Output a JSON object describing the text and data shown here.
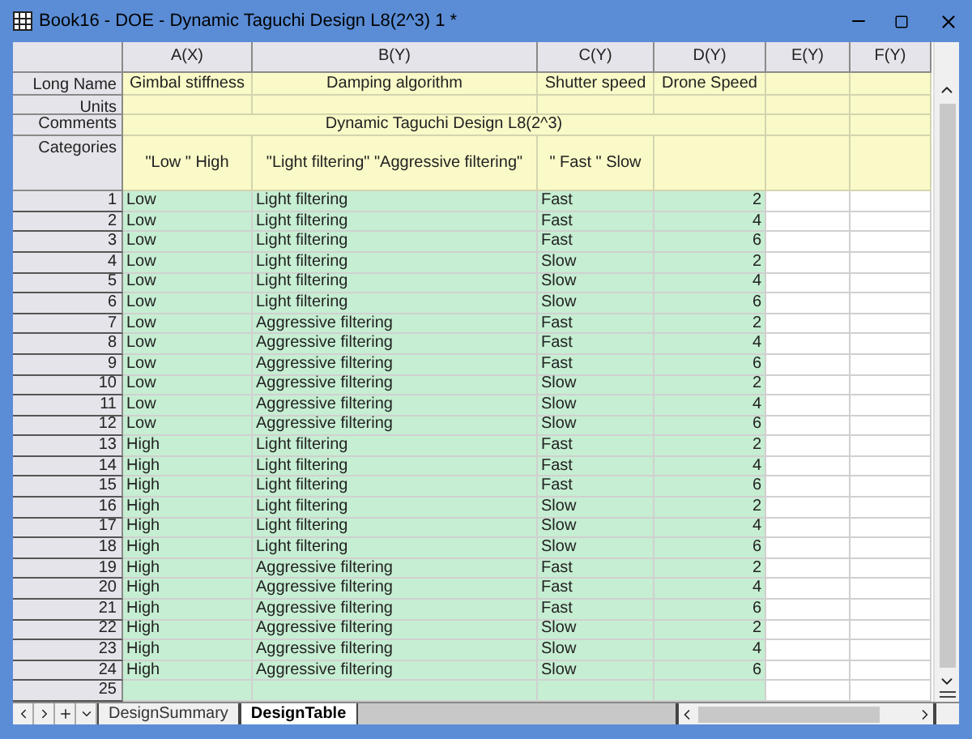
{
  "window": {
    "title": "Book16 - DOE - Dynamic Taguchi Design L8(2^3) 1 *"
  },
  "row_labels": {
    "long_name": "Long Name",
    "units": "Units",
    "comments": "Comments",
    "categories": "Categories"
  },
  "comments": "Dynamic Taguchi Design L8(2^3)",
  "columns": [
    {
      "label": "A(X)",
      "kind": "text",
      "long_name": "Gimbal stiffness",
      "categories": "\"Low \" High"
    },
    {
      "label": "B(Y)",
      "kind": "text",
      "long_name": "Damping algorithm",
      "categories": "\"Light filtering\" \"Aggressive filtering\""
    },
    {
      "label": "C(Y)",
      "kind": "text",
      "long_name": "Shutter speed",
      "categories": "\" Fast \" Slow"
    },
    {
      "label": "D(Y)",
      "kind": "numeric",
      "long_name": "Drone Speed"
    },
    {
      "label": "E(Y)",
      "kind": "empty"
    },
    {
      "label": "F(Y)",
      "kind": "empty"
    }
  ],
  "rows": [
    {
      "number": "1",
      "cells": [
        "Low",
        "Light filtering",
        "Fast",
        "2"
      ]
    },
    {
      "number": "2",
      "cells": [
        "Low",
        "Light filtering",
        "Fast",
        "4"
      ]
    },
    {
      "number": "3",
      "cells": [
        "Low",
        "Light filtering",
        "Fast",
        "6"
      ]
    },
    {
      "number": "4",
      "cells": [
        "Low",
        "Light filtering",
        "Slow",
        "2"
      ]
    },
    {
      "number": "5",
      "cells": [
        "Low",
        "Light filtering",
        "Slow",
        "4"
      ]
    },
    {
      "number": "6",
      "cells": [
        "Low",
        "Light filtering",
        "Slow",
        "6"
      ]
    },
    {
      "number": "7",
      "cells": [
        "Low",
        "Aggressive filtering",
        "Fast",
        "2"
      ]
    },
    {
      "number": "8",
      "cells": [
        "Low",
        "Aggressive filtering",
        "Fast",
        "4"
      ]
    },
    {
      "number": "9",
      "cells": [
        "Low",
        "Aggressive filtering",
        "Fast",
        "6"
      ]
    },
    {
      "number": "10",
      "cells": [
        "Low",
        "Aggressive filtering",
        "Slow",
        "2"
      ]
    },
    {
      "number": "11",
      "cells": [
        "Low",
        "Aggressive filtering",
        "Slow",
        "4"
      ]
    },
    {
      "number": "12",
      "cells": [
        "Low",
        "Aggressive filtering",
        "Slow",
        "6"
      ]
    },
    {
      "number": "13",
      "cells": [
        "High",
        "Light filtering",
        "Fast",
        "2"
      ]
    },
    {
      "number": "14",
      "cells": [
        "High",
        "Light filtering",
        "Fast",
        "4"
      ]
    },
    {
      "number": "15",
      "cells": [
        "High",
        "Light filtering",
        "Fast",
        "6"
      ]
    },
    {
      "number": "16",
      "cells": [
        "High",
        "Light filtering",
        "Slow",
        "2"
      ]
    },
    {
      "number": "17",
      "cells": [
        "High",
        "Light filtering",
        "Slow",
        "4"
      ]
    },
    {
      "number": "18",
      "cells": [
        "High",
        "Light filtering",
        "Slow",
        "6"
      ]
    },
    {
      "number": "19",
      "cells": [
        "High",
        "Aggressive filtering",
        "Fast",
        "2"
      ]
    },
    {
      "number": "20",
      "cells": [
        "High",
        "Aggressive filtering",
        "Fast",
        "4"
      ]
    },
    {
      "number": "21",
      "cells": [
        "High",
        "Aggressive filtering",
        "Fast",
        "6"
      ]
    },
    {
      "number": "22",
      "cells": [
        "High",
        "Aggressive filtering",
        "Slow",
        "2"
      ]
    },
    {
      "number": "23",
      "cells": [
        "High",
        "Aggressive filtering",
        "Slow",
        "4"
      ]
    },
    {
      "number": "24",
      "cells": [
        "High",
        "Aggressive filtering",
        "Slow",
        "6"
      ]
    },
    {
      "number": "25"
    }
  ],
  "sheet_tabs": [
    {
      "label": "DesignSummary",
      "selected": false
    },
    {
      "label": "DesignTable",
      "selected": true
    }
  ]
}
